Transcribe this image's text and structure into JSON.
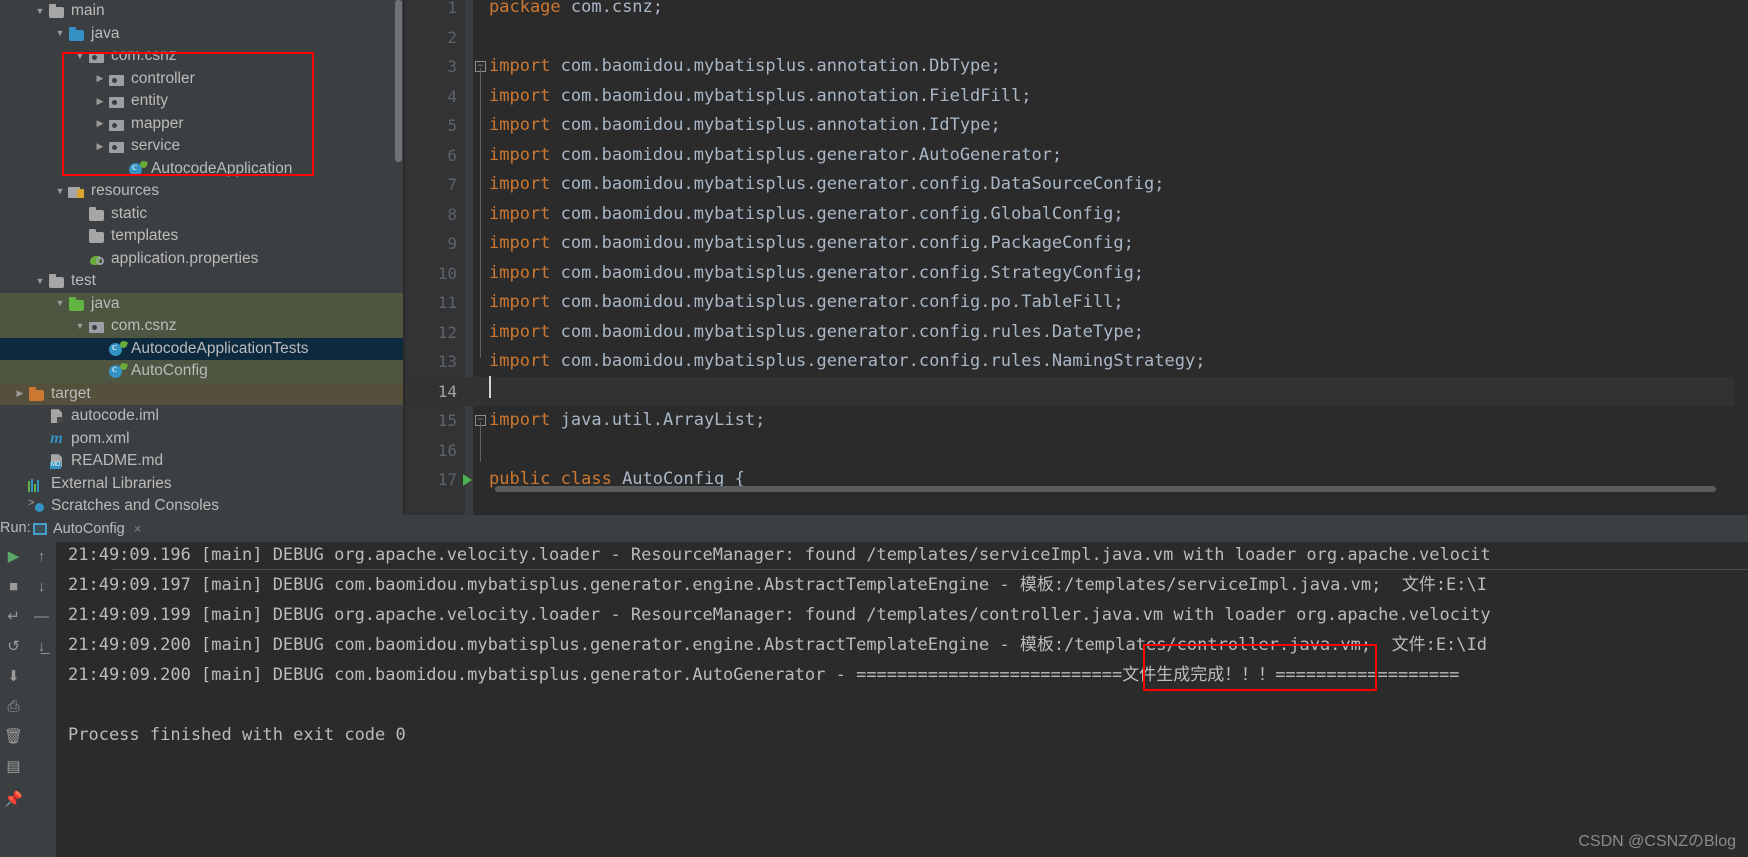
{
  "project_tree": [
    {
      "label": "main",
      "depth": 1,
      "arrow": "down",
      "icon": "folder",
      "sel": "none"
    },
    {
      "label": "java",
      "depth": 2,
      "arrow": "down",
      "icon": "folder-blue",
      "sel": "none"
    },
    {
      "label": "com.csnz",
      "depth": 3,
      "arrow": "down",
      "icon": "pkg",
      "sel": "none"
    },
    {
      "label": "controller",
      "depth": 4,
      "arrow": "right",
      "icon": "pkg",
      "sel": "none"
    },
    {
      "label": "entity",
      "depth": 4,
      "arrow": "right",
      "icon": "pkg",
      "sel": "none"
    },
    {
      "label": "mapper",
      "depth": 4,
      "arrow": "right",
      "icon": "pkg",
      "sel": "none"
    },
    {
      "label": "service",
      "depth": 4,
      "arrow": "right",
      "icon": "pkg",
      "sel": "none"
    },
    {
      "label": "AutocodeApplication",
      "depth": 5,
      "arrow": "none",
      "icon": "spring-class",
      "sel": "none"
    },
    {
      "label": "resources",
      "depth": 2,
      "arrow": "down",
      "icon": "resources-folder",
      "sel": "none"
    },
    {
      "label": "static",
      "depth": 3,
      "arrow": "none",
      "icon": "folder",
      "sel": "none"
    },
    {
      "label": "templates",
      "depth": 3,
      "arrow": "none",
      "icon": "folder",
      "sel": "none"
    },
    {
      "label": "application.properties",
      "depth": 3,
      "arrow": "none",
      "icon": "properties-file",
      "sel": "none"
    },
    {
      "label": "test",
      "depth": 1,
      "arrow": "down",
      "icon": "folder",
      "sel": "none"
    },
    {
      "label": "java",
      "depth": 2,
      "arrow": "down",
      "icon": "folder-green",
      "sel": "green"
    },
    {
      "label": "com.csnz",
      "depth": 3,
      "arrow": "down",
      "icon": "pkg",
      "sel": "green"
    },
    {
      "label": "AutocodeApplicationTests",
      "depth": 4,
      "arrow": "none",
      "icon": "spring-class",
      "sel": "blue"
    },
    {
      "label": "AutoConfig",
      "depth": 4,
      "arrow": "none",
      "icon": "spring-class",
      "sel": "green"
    },
    {
      "label": "target",
      "depth": 0,
      "arrow": "right",
      "icon": "folder-orange",
      "sel": "brown"
    },
    {
      "label": "autocode.iml",
      "depth": 1,
      "arrow": "none",
      "icon": "iml-file",
      "sel": "none"
    },
    {
      "label": "pom.xml",
      "depth": 1,
      "arrow": "none",
      "icon": "maven-file",
      "sel": "none"
    },
    {
      "label": "README.md",
      "depth": 1,
      "arrow": "none",
      "icon": "markdown-file",
      "sel": "none"
    },
    {
      "label": "External Libraries",
      "depth": 0,
      "arrow": "none",
      "icon": "libraries",
      "sel": "none"
    },
    {
      "label": "Scratches and Consoles",
      "depth": 0,
      "arrow": "none",
      "icon": "scratches",
      "sel": "none"
    }
  ],
  "editor": {
    "lines": [
      {
        "num": "1",
        "keyword": "package ",
        "rest": "com.csnz;",
        "fold": false,
        "active": false,
        "run": false
      },
      {
        "num": "2",
        "keyword": "",
        "rest": "",
        "fold": false,
        "active": false,
        "run": false
      },
      {
        "num": "3",
        "keyword": "import ",
        "rest": "com.baomidou.mybatisplus.annotation.DbType;",
        "fold": true,
        "active": false,
        "run": false
      },
      {
        "num": "4",
        "keyword": "import ",
        "rest": "com.baomidou.mybatisplus.annotation.FieldFill;",
        "fold": false,
        "active": false,
        "run": false
      },
      {
        "num": "5",
        "keyword": "import ",
        "rest": "com.baomidou.mybatisplus.annotation.IdType;",
        "fold": false,
        "active": false,
        "run": false
      },
      {
        "num": "6",
        "keyword": "import ",
        "rest": "com.baomidou.mybatisplus.generator.AutoGenerator;",
        "fold": false,
        "active": false,
        "run": false
      },
      {
        "num": "7",
        "keyword": "import ",
        "rest": "com.baomidou.mybatisplus.generator.config.DataSourceConfig;",
        "fold": false,
        "active": false,
        "run": false
      },
      {
        "num": "8",
        "keyword": "import ",
        "rest": "com.baomidou.mybatisplus.generator.config.GlobalConfig;",
        "fold": false,
        "active": false,
        "run": false
      },
      {
        "num": "9",
        "keyword": "import ",
        "rest": "com.baomidou.mybatisplus.generator.config.PackageConfig;",
        "fold": false,
        "active": false,
        "run": false
      },
      {
        "num": "10",
        "keyword": "import ",
        "rest": "com.baomidou.mybatisplus.generator.config.StrategyConfig;",
        "fold": false,
        "active": false,
        "run": false
      },
      {
        "num": "11",
        "keyword": "import ",
        "rest": "com.baomidou.mybatisplus.generator.config.po.TableFill;",
        "fold": false,
        "active": false,
        "run": false
      },
      {
        "num": "12",
        "keyword": "import ",
        "rest": "com.baomidou.mybatisplus.generator.config.rules.DateType;",
        "fold": false,
        "active": false,
        "run": false
      },
      {
        "num": "13",
        "keyword": "import ",
        "rest": "com.baomidou.mybatisplus.generator.config.rules.NamingStrategy;",
        "fold": false,
        "active": false,
        "run": false
      },
      {
        "num": "14",
        "keyword": "",
        "rest": "",
        "fold": false,
        "active": true,
        "run": false
      },
      {
        "num": "15",
        "keyword": "import ",
        "rest": "java.util.ArrayList;",
        "fold": true,
        "active": false,
        "run": false
      },
      {
        "num": "16",
        "keyword": "",
        "rest": "",
        "fold": false,
        "active": false,
        "run": false
      },
      {
        "num": "17",
        "keyword": "public class ",
        "rest": "AutoConfig {",
        "fold": false,
        "active": false,
        "run": true
      }
    ]
  },
  "run_window": {
    "label": "Run:",
    "tab_label": "AutoConfig",
    "close_glyph": "×",
    "toolbar": [
      {
        "name": "rerun-button",
        "glyph": "▶"
      },
      {
        "name": "scroll-up-button",
        "glyph": "↑"
      },
      {
        "name": "stop-button",
        "glyph": "■"
      },
      {
        "name": "scroll-down-button",
        "glyph": "↓"
      },
      {
        "name": "soft-wrap-button",
        "glyph": "↵"
      },
      {
        "name": "minus-button",
        "glyph": "—"
      },
      {
        "name": "rerun-failed-button",
        "glyph": "↺"
      },
      {
        "name": "scroll-to-end-button",
        "glyph": "↓̲"
      },
      {
        "name": "export-button",
        "glyph": "⬇"
      },
      {
        "name": "print-button",
        "glyph": "⎙"
      },
      {
        "name": "clear-all-button",
        "glyph": "🗑"
      },
      {
        "name": "layout-button",
        "glyph": "▤"
      },
      {
        "name": "pin-button",
        "glyph": "📌"
      }
    ],
    "console_lines": [
      "21:49:09.196 [main] DEBUG org.apache.velocity.loader - ResourceManager: found /templates/serviceImpl.java.vm with loader org.apache.velocit",
      "21:49:09.197 [main] DEBUG com.baomidou.mybatisplus.generator.engine.AbstractTemplateEngine - 模板:/templates/serviceImpl.java.vm;  文件:E:\\I",
      "21:49:09.199 [main] DEBUG org.apache.velocity.loader - ResourceManager: found /templates/controller.java.vm with loader org.apache.velocity",
      "21:49:09.200 [main] DEBUG com.baomidou.mybatisplus.generator.engine.AbstractTemplateEngine - 模板:/templates/controller.java.vm;  文件:E:\\Id",
      "21:49:09.200 [main] DEBUG com.baomidou.mybatisplus.generator.AutoGenerator - ==========================文件生成完成！！！==================",
      "",
      "Process finished with exit code 0"
    ]
  },
  "watermark": "CSDN @CSNZのBlog"
}
